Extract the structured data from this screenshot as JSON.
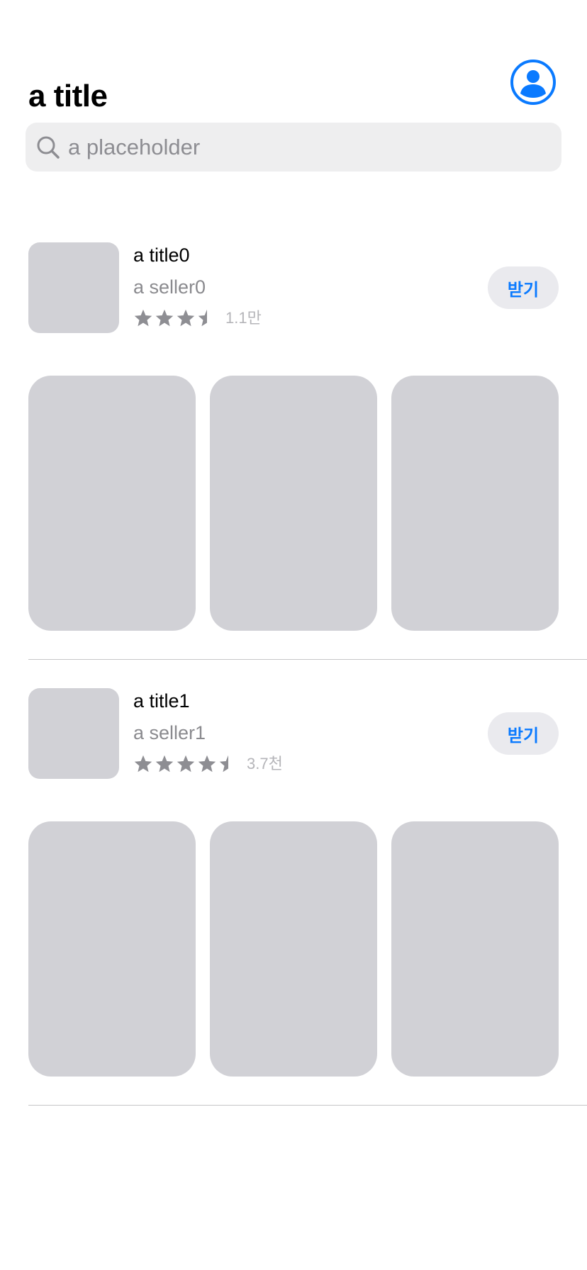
{
  "header": {
    "title": "a title",
    "account_icon": "person-circle-icon",
    "accent_color": "#0a7aff"
  },
  "search": {
    "icon": "search-icon",
    "placeholder": "a placeholder",
    "value": ""
  },
  "apps": [
    {
      "title": "a title0",
      "seller": "a seller0",
      "rating": 3.5,
      "rating_count": "1.1만",
      "get_label": "받기",
      "screenshot_count": 3
    },
    {
      "title": "a title1",
      "seller": "a seller1",
      "rating": 4.5,
      "rating_count": "3.7천",
      "get_label": "받기",
      "screenshot_count": 3
    }
  ],
  "colors": {
    "placeholder_gray": "#d1d1d6",
    "star_gray": "#8e8e93",
    "button_bg": "#eaeaee"
  }
}
